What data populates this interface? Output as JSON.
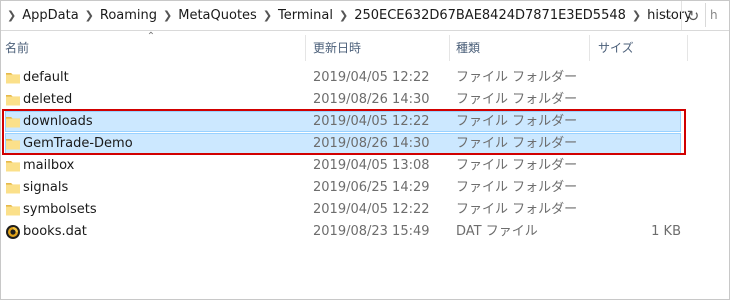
{
  "breadcrumb": {
    "items": [
      "AppData",
      "Roaming",
      "MetaQuotes",
      "Terminal",
      "250ECE632D67BAE8424D7871E3ED5548",
      "history"
    ],
    "search_partial": "h"
  },
  "columns": {
    "name": "名前",
    "date": "更新日時",
    "type": "種類",
    "size": "サイズ"
  },
  "files": [
    {
      "name": "default",
      "date": "2019/04/05 12:22",
      "type": "ファイル フォルダー",
      "size": "",
      "icon": "folder-icon"
    },
    {
      "name": "deleted",
      "date": "2019/08/26 14:30",
      "type": "ファイル フォルダー",
      "size": "",
      "icon": "folder-icon"
    },
    {
      "name": "downloads",
      "date": "2019/04/05 12:22",
      "type": "ファイル フォルダー",
      "size": "",
      "icon": "folder-icon"
    },
    {
      "name": "GemTrade-Demo",
      "date": "2019/08/26 14:30",
      "type": "ファイル フォルダー",
      "size": "",
      "icon": "folder-icon"
    },
    {
      "name": "mailbox",
      "date": "2019/04/05 13:08",
      "type": "ファイル フォルダー",
      "size": "",
      "icon": "folder-icon"
    },
    {
      "name": "signals",
      "date": "2019/06/25 14:29",
      "type": "ファイル フォルダー",
      "size": "",
      "icon": "folder-icon"
    },
    {
      "name": "symbolsets",
      "date": "2019/04/05 12:22",
      "type": "ファイル フォルダー",
      "size": "",
      "icon": "folder-icon"
    },
    {
      "name": "books.dat",
      "date": "2019/08/23 15:49",
      "type": "DAT ファイル",
      "size": "1 KB",
      "icon": "dat-file-icon"
    }
  ],
  "colors": {
    "selection_fill": "#cce8ff",
    "selection_border": "#99d1ff",
    "annotation_red": "#d10000",
    "folder_yellow": "#f8d775"
  }
}
